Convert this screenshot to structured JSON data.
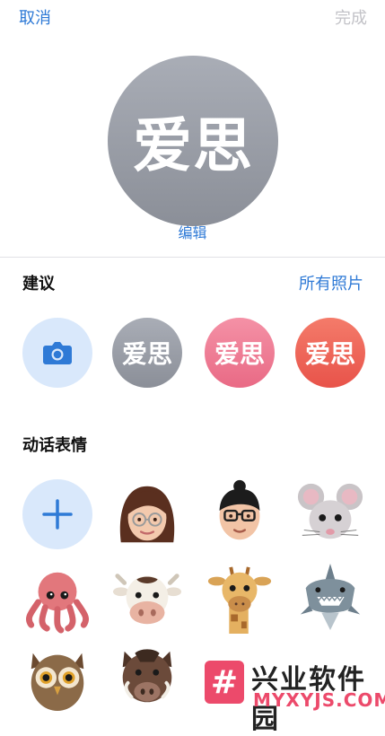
{
  "nav": {
    "cancel_label": "取消",
    "done_label": "完成"
  },
  "profile": {
    "avatar_text": "爱思",
    "edit_label": "编辑"
  },
  "suggestions": {
    "title": "建议",
    "see_all_label": "所有照片",
    "items": [
      {
        "kind": "camera",
        "icon": "camera-icon"
      },
      {
        "kind": "monogram",
        "text": "爱思",
        "color": "#999ca4"
      },
      {
        "kind": "monogram",
        "text": "爱思",
        "color": "#ee7b94"
      },
      {
        "kind": "monogram",
        "text": "爱思",
        "color": "#ec6356"
      }
    ]
  },
  "animoji": {
    "title": "动话表情",
    "add_icon": "plus-icon",
    "items": [
      "memoji-woman",
      "memoji-man",
      "mouse",
      "octopus",
      "cow",
      "giraffe",
      "shark",
      "owl",
      "boar"
    ]
  },
  "watermark": {
    "brand_cn": "兴业软件园",
    "brand_en": "MYXYJS.COM",
    "logo_glyph": "#"
  },
  "colors": {
    "accent": "#2f7ad6",
    "disabled": "#c2c2c7"
  }
}
